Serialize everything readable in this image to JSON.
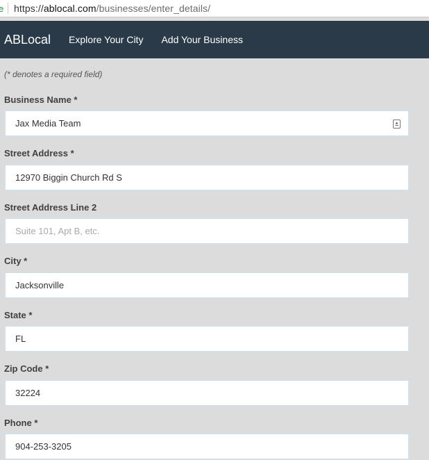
{
  "browser": {
    "url_scheme": "https://",
    "url_host": "ablocal.com",
    "url_path": "/businesses/enter_details/",
    "secure_glyph": "e"
  },
  "navbar": {
    "brand": "ABLocal",
    "links": [
      "Explore Your City",
      "Add Your Business"
    ]
  },
  "form": {
    "required_note": "(* denotes a required field)",
    "fields": [
      {
        "label": "Business Name *",
        "value": "Jax Media Team",
        "placeholder": ""
      },
      {
        "label": "Street Address *",
        "value": "12970 Biggin Church Rd S",
        "placeholder": ""
      },
      {
        "label": "Street Address Line 2",
        "value": "",
        "placeholder": "Suite 101, Apt B, etc."
      },
      {
        "label": "City *",
        "value": "Jacksonville",
        "placeholder": ""
      },
      {
        "label": "State *",
        "value": "FL",
        "placeholder": ""
      },
      {
        "label": "Zip Code *",
        "value": "32224",
        "placeholder": ""
      },
      {
        "label": "Phone *",
        "value": "904-253-3205",
        "placeholder": ""
      }
    ],
    "autofill_icon": "contact-card-icon"
  }
}
